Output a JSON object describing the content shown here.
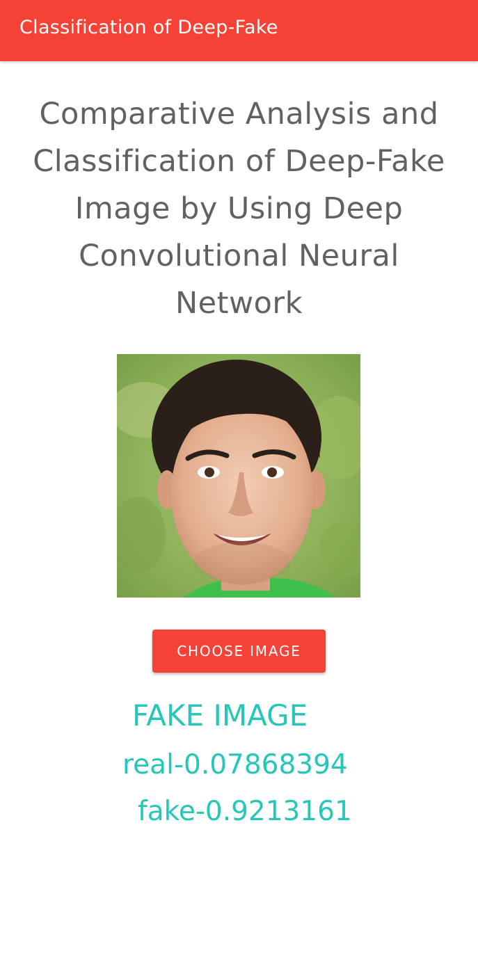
{
  "app_bar": {
    "title": "Classification of Deep-Fake",
    "color": "#f44336"
  },
  "heading": {
    "lines": [
      "Comparative Analysis and",
      "Classification of Deep-Fake",
      "Image by Using Deep",
      "Convolutional Neural",
      "Network"
    ]
  },
  "preview_image": {
    "icon": "face-photo"
  },
  "choose_button": {
    "label": "CHOOSE IMAGE"
  },
  "result": {
    "verdict": "FAKE IMAGE",
    "real_score": "real-0.07868394",
    "fake_score": "fake-0.9213161",
    "color": "#26c6b9"
  }
}
